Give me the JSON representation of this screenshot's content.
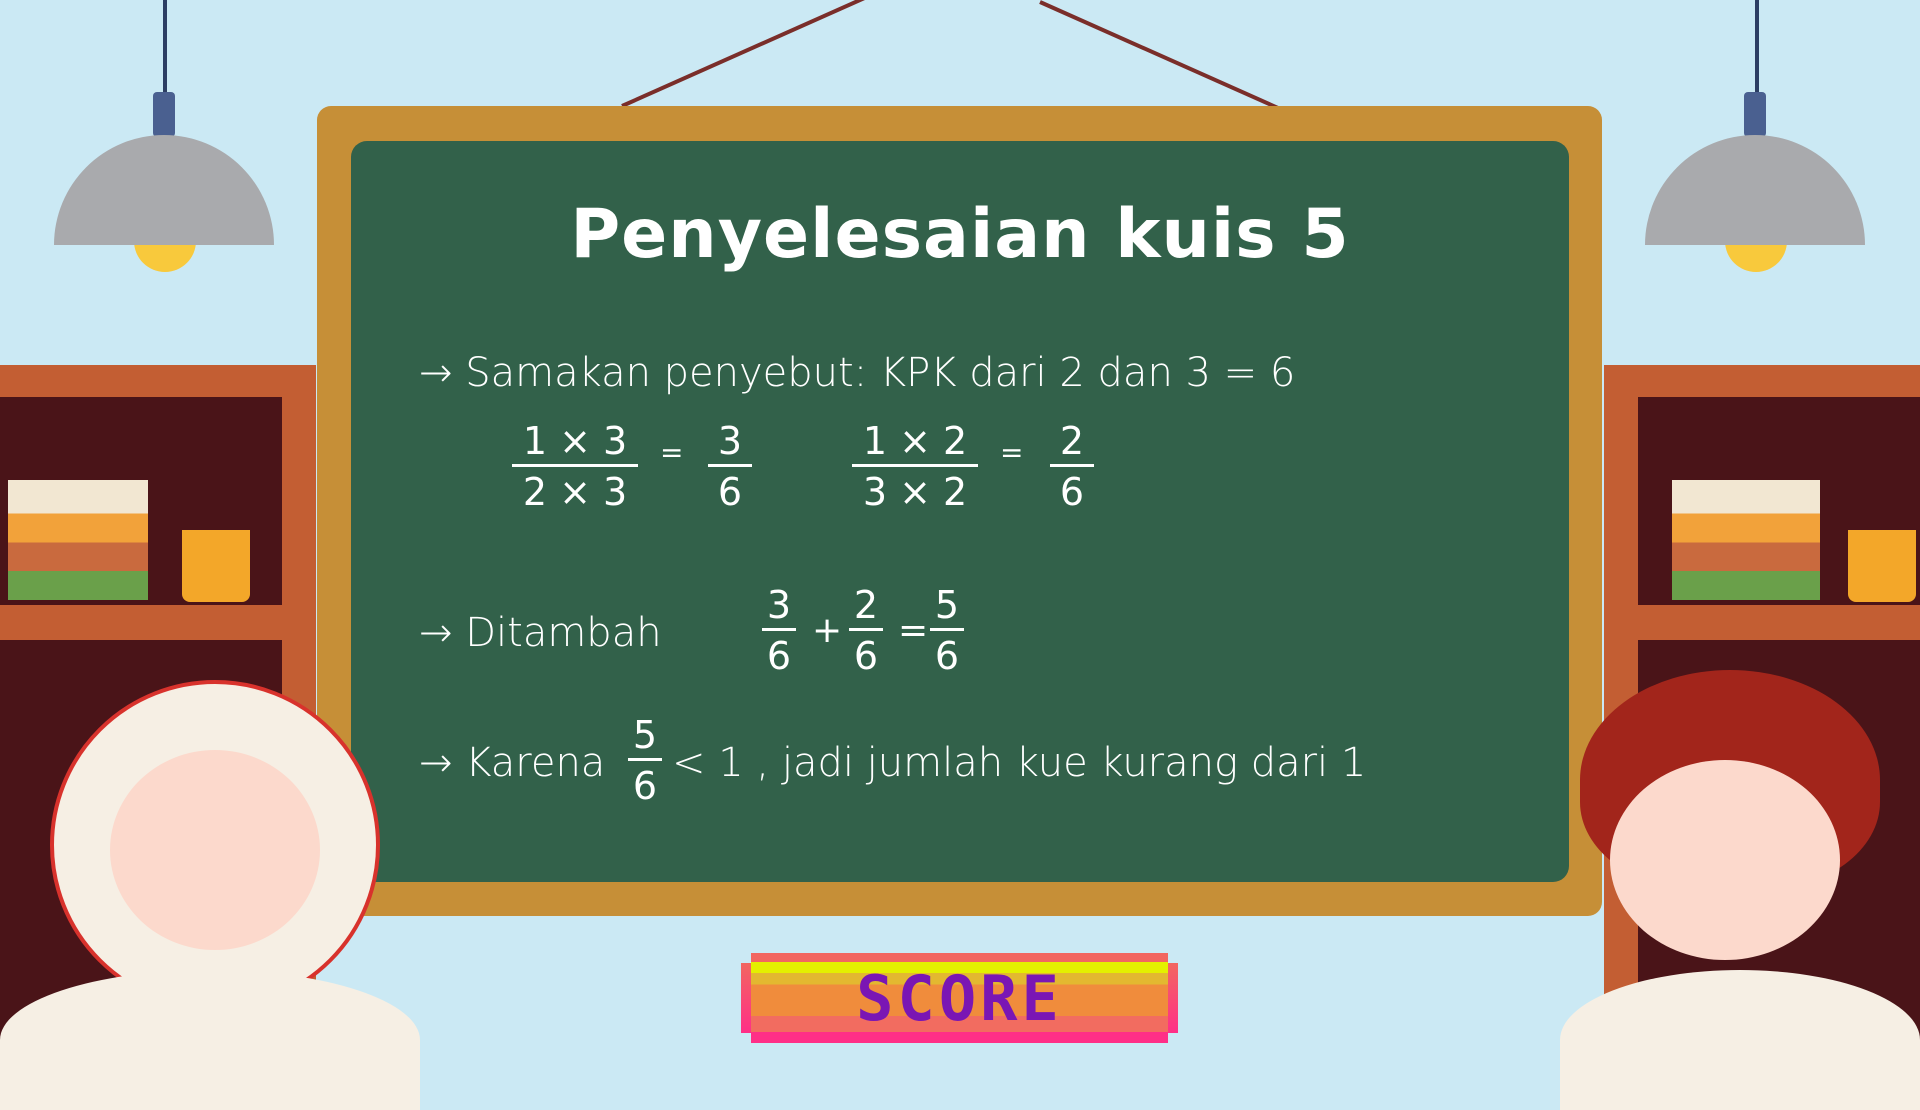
{
  "title": "Penyelesaian kuis 5",
  "steps": {
    "step1": "→ Samakan penyebut: KPK dari 2 dan 3 = 6",
    "frac_a": {
      "num": "1 × 3",
      "den": "2 × 3",
      "eq": "=",
      "res_num": "3",
      "res_den": "6"
    },
    "frac_b": {
      "num": "1 × 2",
      "den": "3 × 2",
      "eq": "=",
      "res_num": "2",
      "res_den": "6"
    },
    "step2_label": "→ Ditambah",
    "sum": {
      "a_num": "3",
      "a_den": "6",
      "plus": "+",
      "b_num": "2",
      "b_den": "6",
      "eq": "=",
      "r_num": "5",
      "r_den": "6"
    },
    "step3_prefix": "→ Karena",
    "step3_num": "5",
    "step3_den": "6",
    "step3_suffix": "< 1 , jadi jumlah kue kurang dari 1"
  },
  "score_button": "SCORE",
  "colors": {
    "board": "#32614a",
    "frame": "#c68f37",
    "background": "#cbe9f4",
    "score_text": "#7a16b4"
  }
}
